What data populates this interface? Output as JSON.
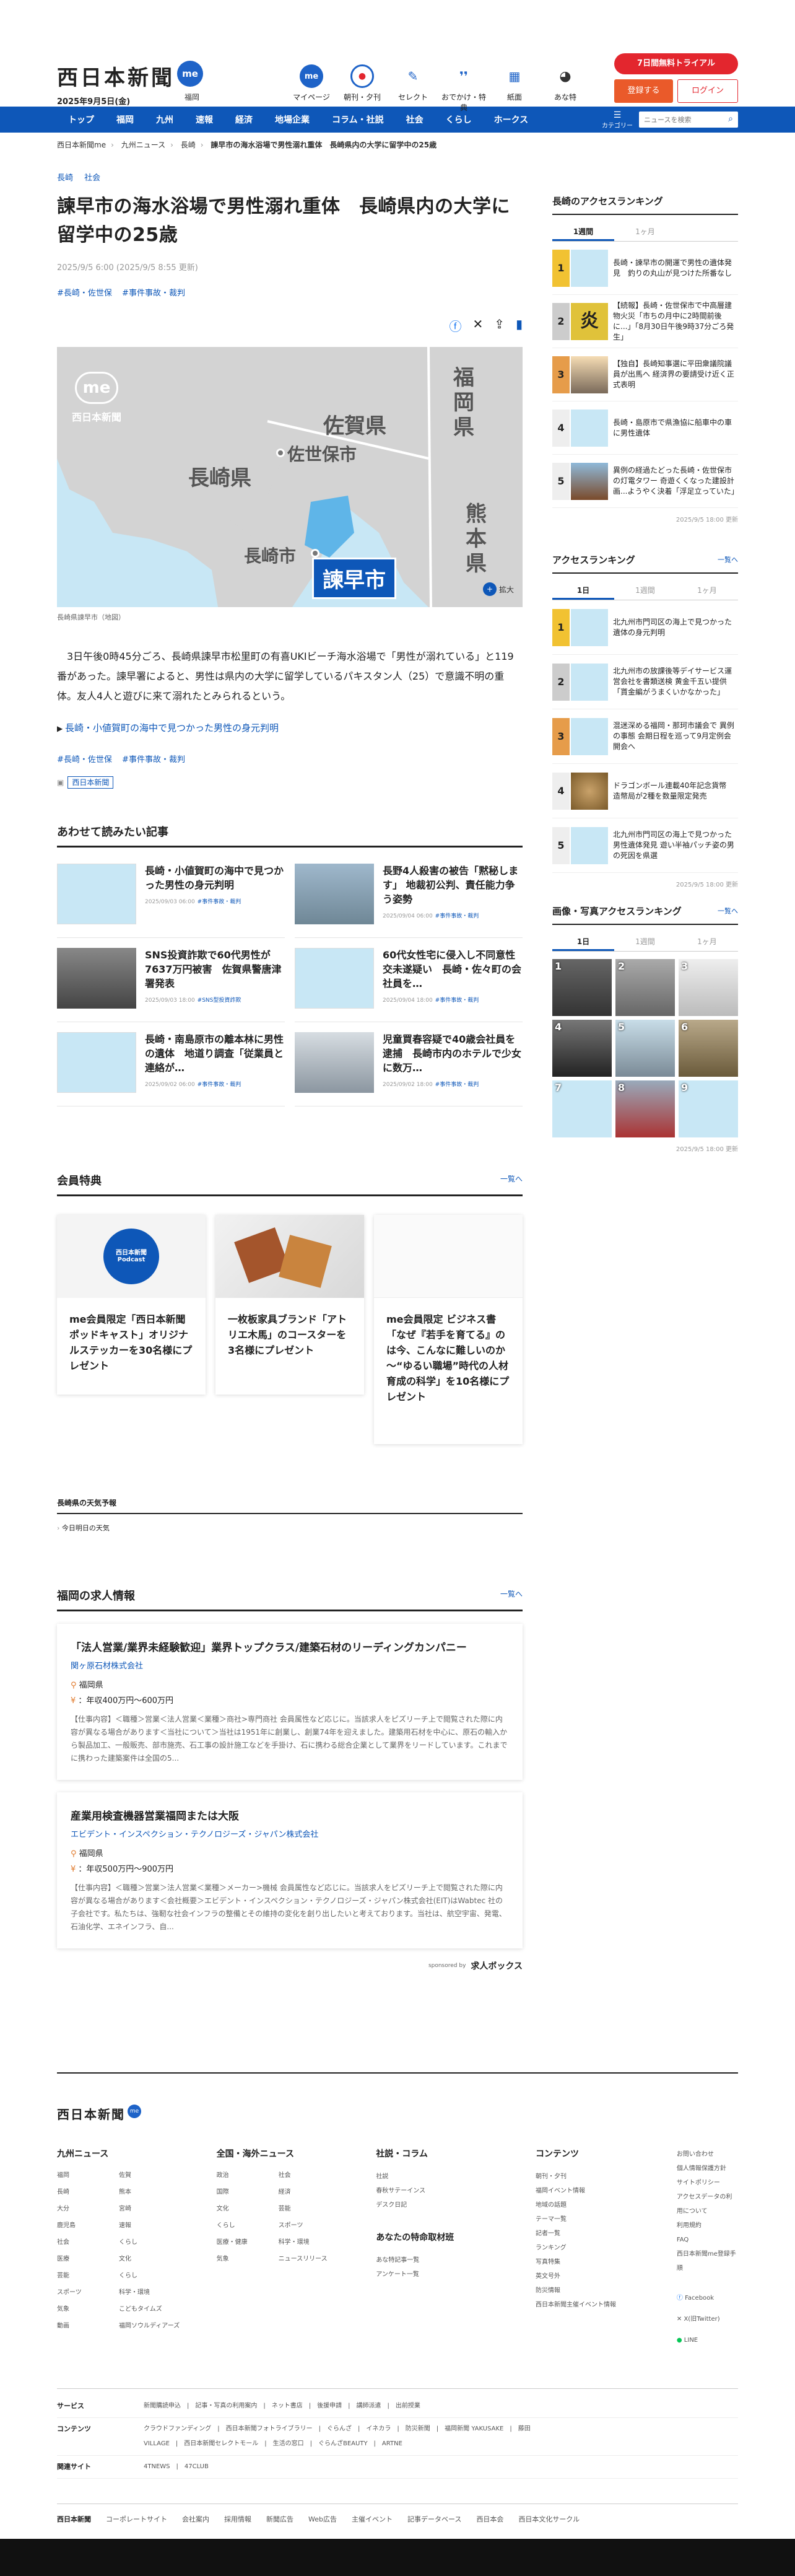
{
  "header": {
    "logo": "西日本新聞",
    "me": "me",
    "date": "2025年9月5日(金)",
    "location": "福岡",
    "icons": [
      {
        "label": "マイページ",
        "icon": "me-icon"
      },
      {
        "label": "朝刊・夕刊",
        "icon": "newspaper-icon"
      },
      {
        "label": "セレクト",
        "icon": "select-icon"
      },
      {
        "label": "おでかけ・特典",
        "icon": "footsteps-icon"
      },
      {
        "label": "紙面",
        "icon": "paper-icon"
      },
      {
        "label": "あな特",
        "icon": "raccoon-icon"
      }
    ],
    "trial": "7日間無料トライアル",
    "register": "登録する",
    "login": "ログイン"
  },
  "nav": {
    "items": [
      "トップ",
      "福岡",
      "九州",
      "速報",
      "経済",
      "地場企業",
      "コラム・社説",
      "社会",
      "くらし",
      "ホークス"
    ],
    "category": "カテゴリー",
    "search_placeholder": "ニュースを検索"
  },
  "breadcrumb": [
    "西日本新聞me",
    "九州ニュース",
    "長崎",
    "諫早市の海水浴場で男性溺れ重体　長崎県内の大学に留学中の25歳"
  ],
  "article": {
    "categories": [
      "長崎",
      "社会"
    ],
    "title": "諫早市の海水浴場で男性溺れ重体　長崎県内の大学に留学中の25歳",
    "meta": "2025/9/5 6:00 (2025/9/5 8:55 更新)",
    "tags": [
      "#長崎・佐世保",
      "#事件事故・裁判"
    ],
    "map_labels": {
      "logo": "西日本新聞",
      "fukuoka": "福岡県",
      "saga": "佐賀県",
      "sasebo": "佐世保市",
      "nagasaki_pref": "長崎県",
      "kumamoto": "熊本県",
      "nagasaki_city": "長崎市",
      "isahaya": "諫早市",
      "zoom": "拡大"
    },
    "caption": "長崎県諫早市（地図）",
    "body": "　3日午後0時45分ごろ、長崎県諫早市松里町の有喜UKIビーチ海水浴場で「男性が溺れている」と119番があった。諫早署によると、男性は県内の大学に留学しているパキスタン人（25）で意識不明の重体。友人4人と遊びに来て溺れたとみられるという。",
    "related_link": "長崎・小値賀町の海中で見つかった男性の身元判明",
    "tags2": [
      "#長崎・佐世保",
      "#事件事故・裁判"
    ],
    "reporter": "西日本新聞"
  },
  "related": {
    "title": "あわせて読みたい記事",
    "items": [
      {
        "title": "長崎・小値賀町の海中で見つかった男性の身元判明",
        "date": "2025/09/03 06:00",
        "tag": "#事件事故・裁判"
      },
      {
        "title": "長野4人殺害の被告「黙秘します」 地裁初公判、責任能力争う姿勢",
        "date": "2025/09/04 06:00",
        "tag": "#事件事故・裁判"
      },
      {
        "title": "SNS投資詐欺で60代男性が7637万円被害　佐賀県警唐津署発表",
        "date": "2025/09/03 18:00",
        "tag": "#SNS型投資詐欺"
      },
      {
        "title": "60代女性宅に侵入し不同意性交未遂疑い　長崎・佐々町の会社員を…",
        "date": "2025/09/04 18:00",
        "tag": "#事件事故・裁判"
      },
      {
        "title": "長崎・南島原市の離本林に男性の遺体　地道り調査「従業員と連絡が…",
        "date": "2025/09/02 06:00",
        "tag": "#事件事故・裁判"
      },
      {
        "title": "児童買春容疑で40歳会社員を逮捕　長崎市内のホテルで少女に数万…",
        "date": "2025/09/02 18:00",
        "tag": "#事件事故・裁判"
      }
    ]
  },
  "benefits": {
    "title": "会員特典",
    "more": "一覧へ",
    "items": [
      "me会員限定「西日本新聞ポッドキャスト」オリジナルステッカーを30名様にプレゼント",
      "一枚板家具ブランド「アトリエ木馬」のコースターを3名様にプレゼント",
      "me会員限定 ビジネス書「なぜ『若手を育てる』のは今、こんなに難しいのか ～“ゆるい職場”時代の人材育成の科学」を10名様にプレゼント"
    ],
    "podcast": "西日本新聞 Podcast"
  },
  "weather": {
    "title": "長崎県の天気予報",
    "tab": "今日明日の天気"
  },
  "jobs": {
    "title": "福岡の求人情報",
    "more": "一覧へ",
    "items": [
      {
        "title": "「法人営業/業界未経験歓迎」業界トップクラス/建築石材のリーディングカンパニー",
        "company": "関ヶ原石材株式会社",
        "location": "福岡県",
        "salary": "：年収400万円～600万円",
        "desc": "【仕事内容】＜職種＞営業＜法人営業＜業種＞商社>専門商社 会員属性など応じに。当該求人をピズリーチ上で閲覧された際に内容が異なる場合があります＜当社について＞当社は1951年に創業し、創業74年を迎えました。建築用石材を中心に、原石の輸入から製品加工、一般販売、部市施売、石工事の設計施工などを手掛け、石に携わる総合企業として業界をリードしています。これまでに携わった建築案件は全国の5..."
      },
      {
        "title": "産業用検査機器営業福岡または大阪",
        "company": "エビデント・インスペクション・テクノロジーズ・ジャパン株式会社",
        "location": "福岡県",
        "salary": "：年収500万円～900万円",
        "desc": "【仕事内容】＜職種＞営業＞法人営業＜業種＞メーカー>機械 会員属性など応じに。当該求人をピズリーチ上で閲覧された際に内容が異なる場合があります＜会社概要＞エビデント・インスペクション・テクノロジーズ・ジャパン株式会社(EIT)はWabtec 社の子会社です。私たちは、強靭な社会インフラの整備とその維持の変化を創り出したいと考えております。当社は、航空宇宙、発電、石油化学、エネインフラ、自..."
      }
    ],
    "sponsor": "sponsored by",
    "sponsor_name": "求人ボックス"
  },
  "sidebar": {
    "access": {
      "title": "長崎のアクセスランキング",
      "tabs": [
        "1週間",
        "1ヶ月"
      ],
      "items": [
        "長崎・諫早市の開運で男性の遺体発見　釣りの丸山が見つけた所番なし",
        "【続報】長崎・佐世保市で中高層建物火災「市ちの月中に2時間前後に...」「8月30日午後9時37分ごろ発生」",
        "【独自】長崎知事選に平田衆議院議員が出馬へ 経済界の要請受け近く正式表明",
        "長崎・島原市で県漁協に船車中の車に男性遺体",
        "異例の経過たどった長崎・佐世保市の灯電タワー 奇遊くくなった建設計画...ようやく決着「浮足立っていた」"
      ],
      "updated": "2025/9/5 18:00 更新"
    },
    "ranking": {
      "title": "アクセスランキング",
      "more": "一覧へ",
      "tabs": [
        "1日",
        "1週間",
        "1ヶ月"
      ],
      "items": [
        "北九州市門司区の海上で見つかった遺体の身元判明",
        "北九州市の放課後等デイサービス運営会社を書類送検 黄金千五い提供「貰金編がうまくいかなかった」",
        "混迷深める福岡・那珂市議会で 異例の事態 会期日程を巡って9月定例会開会へ",
        "ドラゴンボール連載40年記念貨幣　造幣局が2種を数量限定発売",
        "北九州市門司区の海上で見つかった男性遺体発見 遊い半袖パッチ姿の男の死因を県選"
      ],
      "updated": "2025/9/5 18:00 更新"
    },
    "photo": {
      "title": "画像・写真アクセスランキング",
      "more": "一覧へ",
      "tabs": [
        "1日",
        "1週間",
        "1ヶ月"
      ],
      "nums": [
        "1",
        "2",
        "3",
        "4",
        "5",
        "6",
        "7",
        "8",
        "9"
      ],
      "updated": "2025/9/5 18:00 更新"
    }
  },
  "footer": {
    "logo": "西日本新聞",
    "cols": [
      {
        "title": "九州ニュース",
        "links": [
          "福岡",
          "佐賀",
          "長崎",
          "熊本",
          "大分",
          "宮崎",
          "鹿児島",
          "速報",
          "社会",
          "くらし",
          "医療",
          "文化",
          "芸能",
          "くらし",
          "スポーツ",
          "科学・環境",
          "気象",
          "こどもタイムズ",
          "動画",
          "福岡ソウルディアーズ"
        ]
      },
      {
        "title": "全国・海外ニュース",
        "links": [
          "政治",
          "社会",
          "国際",
          "経済",
          "文化",
          "芸能",
          "くらし",
          "スポーツ",
          "医療・健康",
          "科学・環境",
          "気象",
          "ニュースリリース"
        ]
      },
      {
        "title": "社説・コラム",
        "links": [
          "社説",
          "春秋サテーインス",
          "デスク日記"
        ],
        "sub_title": "あなたの特命取材班",
        "sub_links": [
          "あな特記事一覧",
          "アンケート一覧"
        ]
      },
      {
        "title": "コンテンツ",
        "links": [
          "朝刊・夕刊",
          "福岡イベント情報",
          "地域の話題",
          "テーマ一覧",
          "記者一覧",
          "ランキング",
          "写真特集",
          "英文号外",
          "防災情報",
          "西日本新聞主催イベント情報"
        ]
      }
    ],
    "right_links": [
      "お問い合わせ",
      "個人情報保護方針",
      "サイトポリシー",
      "アクセスデータの利用について",
      "利用規約",
      "FAQ",
      "西日本新聞me登録手順"
    ],
    "social": [
      "Facebook",
      "X(旧Twitter)",
      "LINE"
    ],
    "service_rows": [
      {
        "label": "サービス",
        "text": "新聞購読申込　|　記事・写真の利用案内　|　ネット書店　|　後援申請　|　講師派遣　|　出前授業"
      },
      {
        "label": "コンテンツ",
        "text": "クラウドファンディング　|　西日本新聞フォトライブラリー　|　ぐらんざ　|　イネカラ　|　防災新聞　|　福岡新聞 YAKUSAKE　|　藤田VILLAGE　|　西日本新聞セレクトモール　|　生活の窓口　|　ぐらんざBEAUTY　|　ARTNE"
      },
      {
        "label": "関連サイト",
        "text": "4TNEWS　|　47CLUB"
      }
    ],
    "bottom": [
      "西日本新聞",
      "コーポレートサイト",
      "会社案内",
      "採用情報",
      "新聞広告",
      "Web広告",
      "主催イベント",
      "記事データベース",
      "西日本会",
      "西日本文化サークル"
    ]
  }
}
